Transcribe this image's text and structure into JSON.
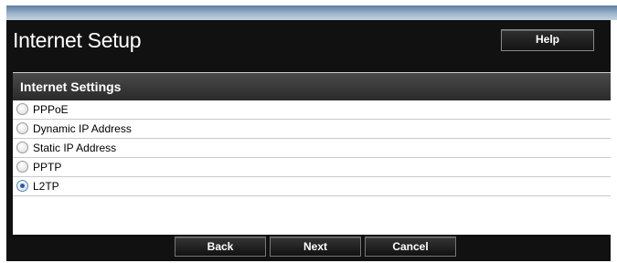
{
  "header": {
    "title": "Internet Setup",
    "help_label": "Help"
  },
  "section": {
    "title": "Internet Settings"
  },
  "options": [
    {
      "label": "PPPoE",
      "checked": false
    },
    {
      "label": "Dynamic IP Address",
      "checked": false
    },
    {
      "label": "Static IP Address",
      "checked": false
    },
    {
      "label": "PPTP",
      "checked": false
    },
    {
      "label": "L2TP",
      "checked": true
    }
  ],
  "buttons": {
    "back": "Back",
    "next": "Next",
    "cancel": "Cancel"
  },
  "colors": {
    "panel_bg": "#111111",
    "radio_selected": "#1f5fb3"
  }
}
